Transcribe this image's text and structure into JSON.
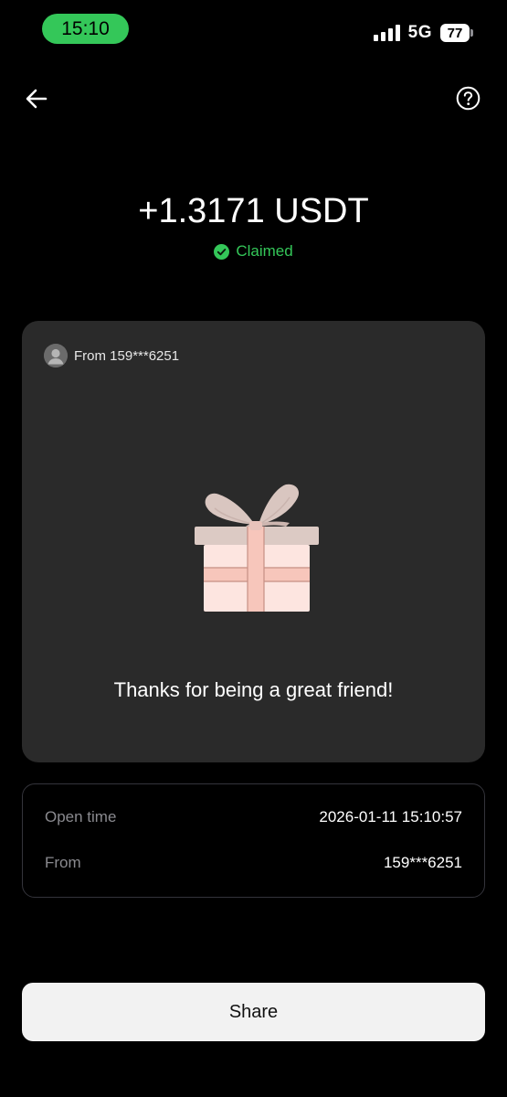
{
  "status_bar": {
    "time": "15:10",
    "network": "5G",
    "battery": "77"
  },
  "nav": {
    "back_icon": "arrow-left-icon",
    "help_icon": "question-circle-icon"
  },
  "amount": {
    "value": "+1.3171 USDT",
    "status": "Claimed",
    "status_icon": "check-circle-icon",
    "status_color": "#34c759"
  },
  "gift_card": {
    "sender": "From 159***6251",
    "avatar_icon": "default-avatar-icon",
    "gift_icon": "gift-box-icon",
    "message": "Thanks for being a great friend!",
    "background": "#2a2a2a"
  },
  "details": [
    {
      "label": "Open time",
      "value": "2026-01-11 15:10:57"
    },
    {
      "label": "From",
      "value": "159***6251"
    }
  ],
  "share_button": {
    "label": "Share"
  }
}
